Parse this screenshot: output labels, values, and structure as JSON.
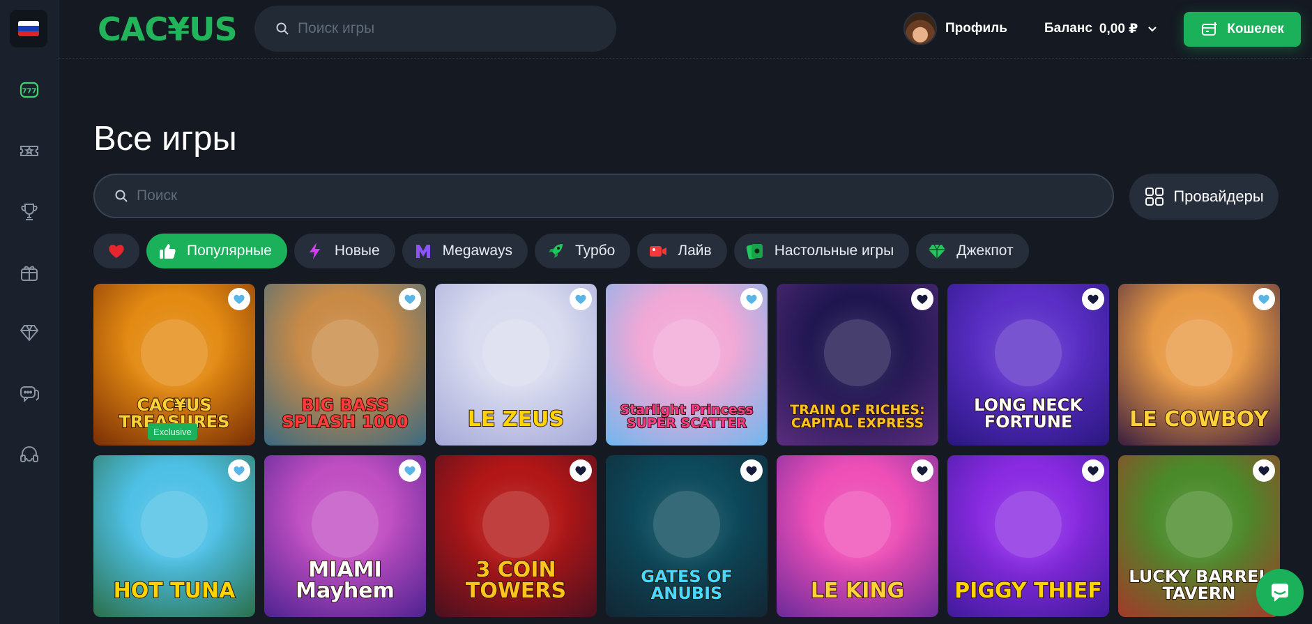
{
  "colors": {
    "accent": "#1bb05a",
    "background": "#151a22",
    "sidebar": "#1b212c",
    "chip": "#262e3b"
  },
  "sidebar": {
    "flag": "russia-flag",
    "items": [
      {
        "icon": "slot-machine-icon",
        "active": true
      },
      {
        "icon": "ticket-icon",
        "active": false
      },
      {
        "icon": "trophy-icon",
        "active": false
      },
      {
        "icon": "gift-box-icon",
        "active": false
      },
      {
        "icon": "diamond-icon",
        "active": false
      },
      {
        "icon": "chat-bubbles-icon",
        "active": false
      },
      {
        "icon": "headset-icon",
        "active": false
      }
    ]
  },
  "header": {
    "logo": "CAC¥US",
    "search_placeholder": "Поиск игры",
    "profile_label": "Профиль",
    "balance_label": "Баланс",
    "balance_value": "0,00 ₽",
    "wallet_label": "Кошелек"
  },
  "main": {
    "title": "Все игры",
    "search_placeholder": "Поиск",
    "providers_label": "Провайдеры",
    "chips": [
      {
        "icon": "heart-icon",
        "label": ""
      },
      {
        "icon": "thumbs-up-icon",
        "label": "Популярные",
        "active": true
      },
      {
        "icon": "lightning-icon",
        "label": "Новые"
      },
      {
        "icon": "megaways-icon",
        "label": "Megaways"
      },
      {
        "icon": "rocket-icon",
        "label": "Турбо"
      },
      {
        "icon": "live-camera-icon",
        "label": "Лайв"
      },
      {
        "icon": "table-games-icon",
        "label": "Настольные игры"
      },
      {
        "icon": "gem-icon",
        "label": "Джекпот"
      }
    ]
  },
  "games": [
    {
      "title": "CAC¥US TREASURES",
      "badge": "Exclusive",
      "heart": "outline",
      "bg": "#e38a12",
      "bg2": "#7a2e05",
      "text": "#ffd23a"
    },
    {
      "title": "BIG BASS SPLASH 1000",
      "heart": "outline",
      "bg": "#c98a46",
      "bg2": "#3a6a82",
      "text": "#ff3b3b"
    },
    {
      "title": "LE ZEUS",
      "heart": "outline",
      "bg": "#d9dcef",
      "bg2": "#a5a8d8",
      "text": "#ffd400"
    },
    {
      "title": "Starlight Princess SUPER SCATTER",
      "heart": "outline",
      "bg": "#f2a8d6",
      "bg2": "#6fb7ef",
      "text": "#ff3c8c"
    },
    {
      "title": "TRAIN OF RICHES: CAPITAL EXPRESS",
      "heart": "filled",
      "bg": "#1f1650",
      "bg2": "#5a2d7d",
      "text": "#ffc21f"
    },
    {
      "title": "LONG NECK FORTUNE",
      "heart": "filled",
      "bg": "#5b2fc7",
      "bg2": "#2a1680",
      "text": "#ffffff"
    },
    {
      "title": "LE COWBOY",
      "heart": "outline",
      "bg": "#e89a45",
      "bg2": "#3a1e40",
      "text": "#ffd23a"
    },
    {
      "title": "HOT TUNA",
      "heart": "outline",
      "bg": "#4ec0e6",
      "bg2": "#2a6f4a",
      "text": "#ffd400"
    },
    {
      "title": "MIAMI Mayhem",
      "heart": "outline",
      "bg": "#c04fc2",
      "bg2": "#4e2290",
      "text": "#ffffff"
    },
    {
      "title": "3 COIN TOWERS",
      "heart": "filled",
      "bg": "#b21616",
      "bg2": "#4a1020",
      "text": "#ffc21f"
    },
    {
      "title": "GATES OF ANUBIS",
      "heart": "filled",
      "bg": "#0c4a5c",
      "bg2": "#122633",
      "text": "#4ad8ff"
    },
    {
      "title": "LE KING",
      "heart": "filled",
      "bg": "#ee4fb7",
      "bg2": "#6b2a9a",
      "text": "#ffd23a"
    },
    {
      "title": "PIGGY THIEF",
      "heart": "filled",
      "bg": "#8a2be2",
      "bg2": "#3f1a9a",
      "text": "#ffd400"
    },
    {
      "title": "LUCKY BARREL TAVERN",
      "heart": "filled",
      "bg": "#4a8a2a",
      "bg2": "#a3392a",
      "text": "#ffffff"
    }
  ]
}
